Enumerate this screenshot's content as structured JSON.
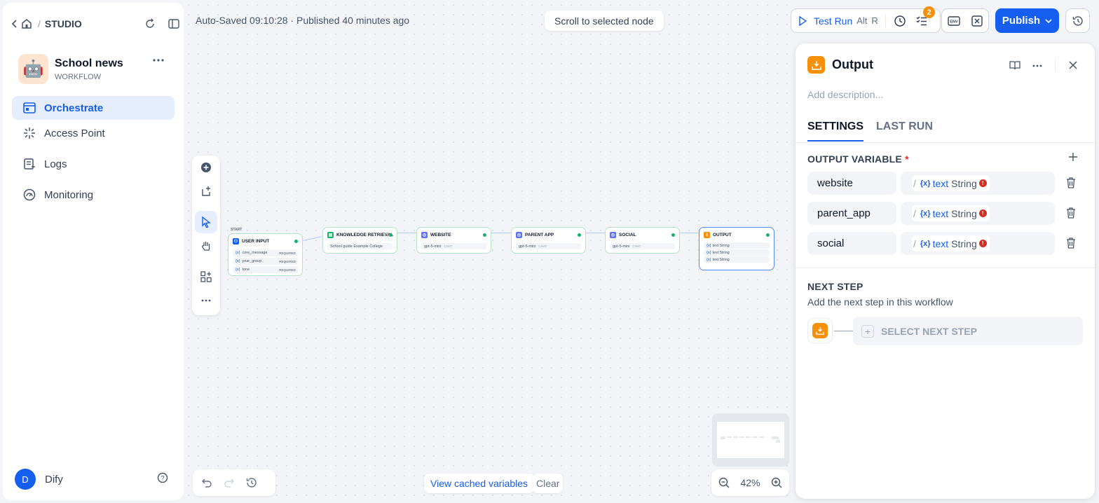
{
  "header": {
    "section": "STUDIO",
    "autosave": "Auto-Saved 09:10:28 · Published 40 minutes ago",
    "scroll_btn": "Scroll to selected node"
  },
  "app": {
    "name": "School news",
    "type": "WORKFLOW"
  },
  "nav": [
    {
      "label": "Orchestrate",
      "active": true
    },
    {
      "label": "Access Point"
    },
    {
      "label": "Logs"
    },
    {
      "label": "Monitoring"
    }
  ],
  "user": {
    "initial": "D",
    "name": "Dify"
  },
  "actions": {
    "test_run": "Test Run",
    "kbd1": "Alt",
    "kbd2": "R",
    "badge": "2",
    "publish": "Publish",
    "accent": "#155eef"
  },
  "nodes": {
    "start_label": "START",
    "user_input": {
      "title": "USER INPUT",
      "vars": [
        "core_message",
        "year_group",
        "tone"
      ],
      "req": "REQUIRED"
    },
    "knowledge": {
      "title": "KNOWLEDGE RETRIEVAL",
      "dataset": "School guide Example College"
    },
    "website": {
      "title": "WEBSITE",
      "model": "gpt-5-mini",
      "mode": "CHAT"
    },
    "parent_app": {
      "title": "PARENT APP",
      "model": "gpt-5-mini",
      "mode": "CHAT"
    },
    "social": {
      "title": "SOCIAL",
      "model": "gpt-5-mini",
      "mode": "CHAT"
    },
    "output": {
      "title": "OUTPUT",
      "rows": [
        "text",
        "text",
        "text"
      ],
      "type": "String"
    }
  },
  "bottom": {
    "cache": "View cached variables",
    "clear": "Clear",
    "zoom": "42%"
  },
  "panel": {
    "title": "Output",
    "description_placeholder": "Add description...",
    "tabs": [
      "SETTINGS",
      "LAST RUN"
    ],
    "output_label": "OUTPUT VARIABLE",
    "required_mark": "*",
    "variables": [
      {
        "name": "website",
        "var": "text",
        "type": "String"
      },
      {
        "name": "parent_app",
        "var": "text",
        "type": "String"
      },
      {
        "name": "social",
        "var": "text",
        "type": "String"
      }
    ],
    "next_title": "NEXT STEP",
    "next_desc": "Add the next step in this workflow",
    "next_btn": "SELECT NEXT STEP",
    "icon_color": "#f79009"
  }
}
